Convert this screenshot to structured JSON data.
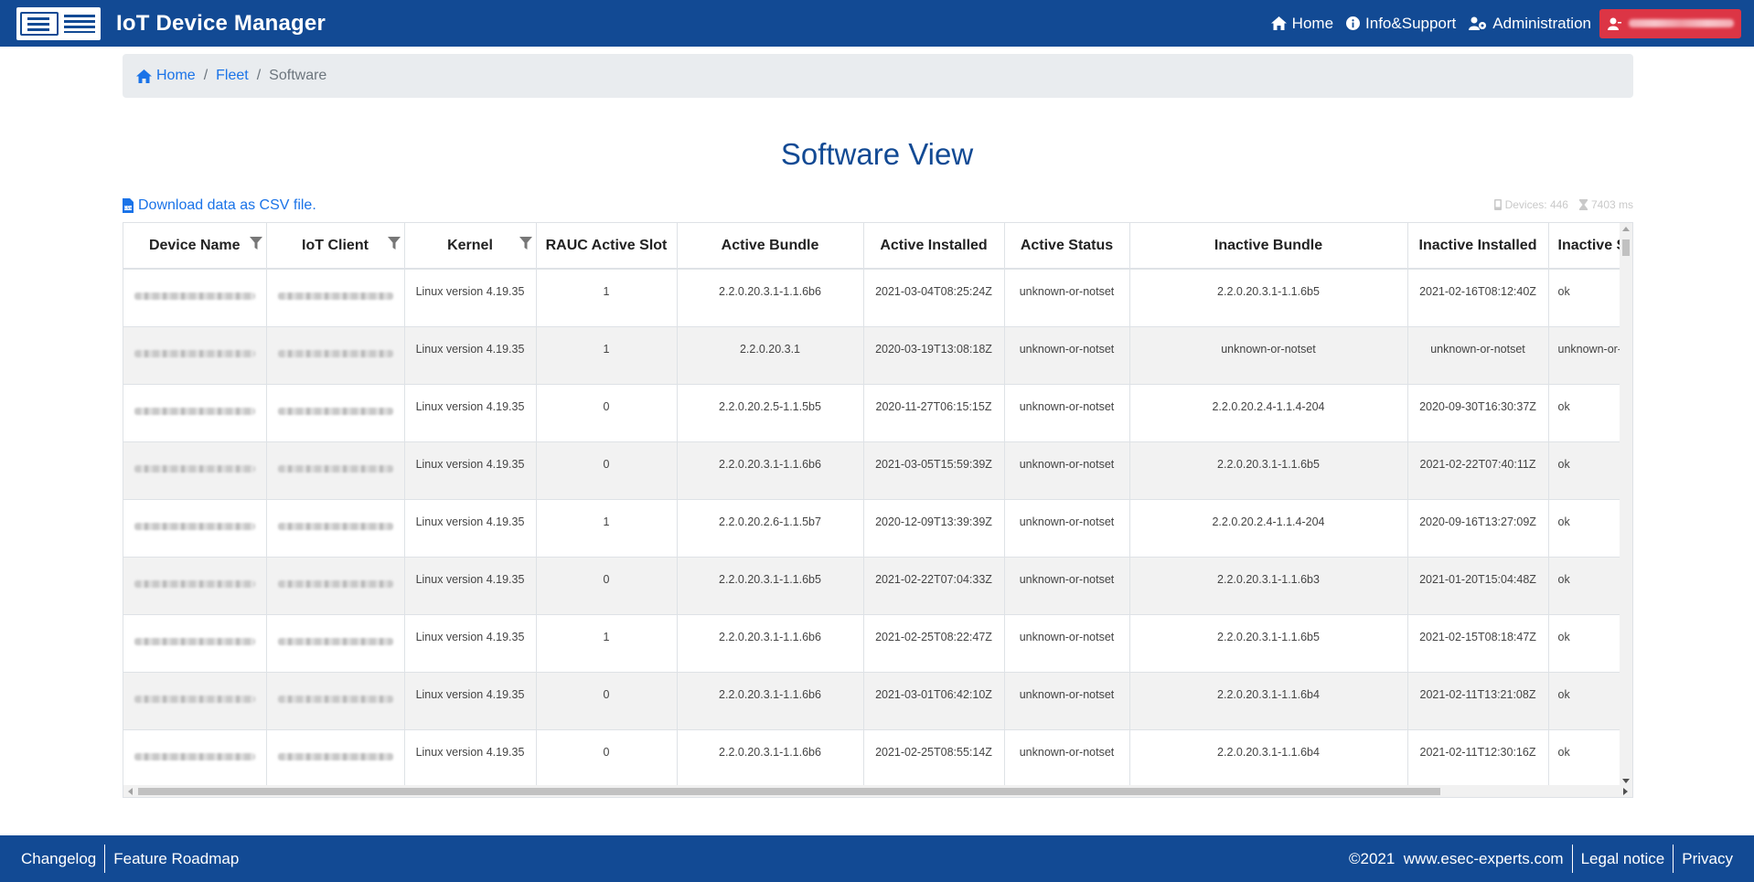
{
  "header": {
    "logo_name": "embedded-security-experts-logo",
    "app_title": "IoT Device Manager",
    "nav": [
      {
        "label": "Home",
        "icon": "home-icon"
      },
      {
        "label": "Info&Support",
        "icon": "info-icon"
      },
      {
        "label": "Administration",
        "icon": "users-cog-icon"
      }
    ],
    "user_icon": "user-icon"
  },
  "breadcrumb": {
    "home": "Home",
    "fleet": "Fleet",
    "separator": "/",
    "current": "Software"
  },
  "page_title": "Software View",
  "csv_link": "Download data as CSV file.",
  "stats": {
    "devices": "Devices: 446",
    "time": "7403 ms"
  },
  "table": {
    "columns": [
      "Device Name",
      "IoT Client",
      "Kernel",
      "RAUC Active Slot",
      "Active Bundle",
      "Active Installed",
      "Active Status",
      "Inactive Bundle",
      "Inactive Installed",
      "Inactive Status"
    ],
    "filter_columns": [
      "Device Name",
      "IoT Client",
      "Kernel"
    ],
    "rows": [
      {
        "kernel": "Linux version 4.19.35",
        "slot": "1",
        "active_bundle": "2.2.0.20.3.1-1.1.6b6",
        "active_installed": "2021-03-04T08:25:24Z",
        "active_status": "unknown-or-notset",
        "inactive_bundle": "2.2.0.20.3.1-1.1.6b5",
        "inactive_installed": "2021-02-16T08:12:40Z",
        "inactive_status": "ok"
      },
      {
        "kernel": "Linux version 4.19.35",
        "slot": "1",
        "active_bundle": "2.2.0.20.3.1",
        "active_installed": "2020-03-19T13:08:18Z",
        "active_status": "unknown-or-notset",
        "inactive_bundle": "unknown-or-notset",
        "inactive_installed": "unknown-or-notset",
        "inactive_status": "unknown-or-notset"
      },
      {
        "kernel": "Linux version 4.19.35",
        "slot": "0",
        "active_bundle": "2.2.0.20.2.5-1.1.5b5",
        "active_installed": "2020-11-27T06:15:15Z",
        "active_status": "unknown-or-notset",
        "inactive_bundle": "2.2.0.20.2.4-1.1.4-204",
        "inactive_installed": "2020-09-30T16:30:37Z",
        "inactive_status": "ok"
      },
      {
        "kernel": "Linux version 4.19.35",
        "slot": "0",
        "active_bundle": "2.2.0.20.3.1-1.1.6b6",
        "active_installed": "2021-03-05T15:59:39Z",
        "active_status": "unknown-or-notset",
        "inactive_bundle": "2.2.0.20.3.1-1.1.6b5",
        "inactive_installed": "2021-02-22T07:40:11Z",
        "inactive_status": "ok"
      },
      {
        "kernel": "Linux version 4.19.35",
        "slot": "1",
        "active_bundle": "2.2.0.20.2.6-1.1.5b7",
        "active_installed": "2020-12-09T13:39:39Z",
        "active_status": "unknown-or-notset",
        "inactive_bundle": "2.2.0.20.2.4-1.1.4-204",
        "inactive_installed": "2020-09-16T13:27:09Z",
        "inactive_status": "ok"
      },
      {
        "kernel": "Linux version 4.19.35",
        "slot": "0",
        "active_bundle": "2.2.0.20.3.1-1.1.6b5",
        "active_installed": "2021-02-22T07:04:33Z",
        "active_status": "unknown-or-notset",
        "inactive_bundle": "2.2.0.20.3.1-1.1.6b3",
        "inactive_installed": "2021-01-20T15:04:48Z",
        "inactive_status": "ok"
      },
      {
        "kernel": "Linux version 4.19.35",
        "slot": "1",
        "active_bundle": "2.2.0.20.3.1-1.1.6b6",
        "active_installed": "2021-02-25T08:22:47Z",
        "active_status": "unknown-or-notset",
        "inactive_bundle": "2.2.0.20.3.1-1.1.6b5",
        "inactive_installed": "2021-02-15T08:18:47Z",
        "inactive_status": "ok"
      },
      {
        "kernel": "Linux version 4.19.35",
        "slot": "0",
        "active_bundle": "2.2.0.20.3.1-1.1.6b6",
        "active_installed": "2021-03-01T06:42:10Z",
        "active_status": "unknown-or-notset",
        "inactive_bundle": "2.2.0.20.3.1-1.1.6b4",
        "inactive_installed": "2021-02-11T13:21:08Z",
        "inactive_status": "ok"
      },
      {
        "kernel": "Linux version 4.19.35",
        "slot": "0",
        "active_bundle": "2.2.0.20.3.1-1.1.6b6",
        "active_installed": "2021-02-25T08:55:14Z",
        "active_status": "unknown-or-notset",
        "inactive_bundle": "2.2.0.20.3.1-1.1.6b4",
        "inactive_installed": "2021-02-11T12:30:16Z",
        "inactive_status": "ok"
      }
    ]
  },
  "footer": {
    "left": [
      "Changelog",
      "Feature Roadmap"
    ],
    "copyright": "©2021",
    "site": "www.esec-experts.com",
    "right": [
      "Legal notice",
      "Privacy"
    ]
  },
  "colors": {
    "brand": "#124a94",
    "link": "#1a73e8",
    "user_button": "#dc3545"
  }
}
